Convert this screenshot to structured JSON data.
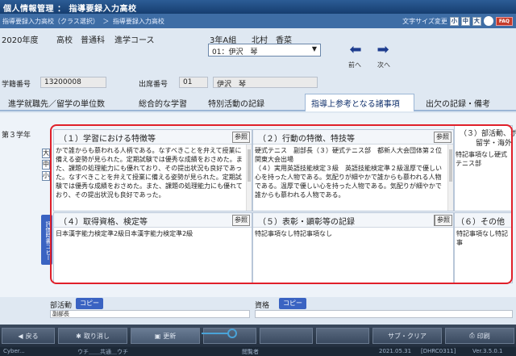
{
  "app": {
    "title": "個人情報管理 ： 指導要録入力高校",
    "breadcrumb": [
      "指導要録入力高校（クラス選択）",
      "＞",
      "指導要録入力高校"
    ],
    "font_size_label": "文字サイズ変更",
    "font_size_buttons": [
      "小",
      "中",
      "大"
    ],
    "faq_button": "FAQ"
  },
  "header": {
    "year": "2020年度",
    "school_type": "高校",
    "course_type": "普通科",
    "course": "進学コース",
    "class": "3年A組",
    "teacher": "北村　香菜",
    "student_select_value": "01：伊沢　琴",
    "prev_label": "前へ",
    "next_label": "次へ"
  },
  "student": {
    "id_label": "学籍番号",
    "id_value": "13200008",
    "seat_label": "出席番号",
    "seat_value": "01",
    "name_value": "伊沢　琴"
  },
  "tabs": [
    {
      "label": "進学就職先／留学の単位数"
    },
    {
      "label": "総合的な学習"
    },
    {
      "label": "特別活動の記録"
    },
    {
      "label": "指導上参考となる諸事項"
    },
    {
      "label": "出欠の記録・備考"
    }
  ],
  "grade": {
    "label": "第３学年",
    "size_buttons": [
      "大",
      "中",
      "小"
    ],
    "copy_vertical": "評価時書コピー"
  },
  "panels": {
    "p1": {
      "title": "（１）学習における特徴等",
      "ref": "参照",
      "body": "かで誰からも慕われる人柄である。なすべきことを弁えて授業に備える姿勢が見られた。定期試験では優秀な成績をおさめた。また、課題の処理能力にも優れており、その提出状況も良好であった。なすべきことを弁えて授業に備える姿勢が見られた。定期試験では優秀な成績をおさめた。また、課題の処理能力にも優れており、その提出状況も良好であった。"
    },
    "p2": {
      "title": "（２）行動の特徴、特技等",
      "ref": "参照",
      "body": "硬式テニス　副部長（３）硬式テニス部　都新人大会団体第２位　関東大会出場\n（４）実用英語技能検定３級　英語技能検定準２級温厚で優しい心を持った人物である。気配りが細やかで誰からも慕われる人物である。温厚で優しい心を持った人物である。気配りが細やかで誰からも慕われる人物である。"
    },
    "p3": {
      "title": "（３）部活動、ボ",
      "subtitle": "留学・海外",
      "body": "特記事項なし硬式テニス部"
    },
    "p4": {
      "title": "（４）取得資格、検定等",
      "ref": "参照",
      "body": "日本漢字能力検定準2級日本漢字能力検定準2級"
    },
    "p5": {
      "title": "（５）表彰・顕彰等の記録",
      "ref": "参照",
      "body": "特記事項なし特記事項なし"
    },
    "p6": {
      "title": "（６）その他",
      "ref": "参照",
      "body": "特記事項なし特記事"
    }
  },
  "lower": {
    "club_label": "部活動",
    "club_copy": "コピー",
    "qual_label": "資格",
    "qual_copy": "コピー",
    "club_box_text": "副部長"
  },
  "toolbar": {
    "buttons": [
      "戻る",
      "取り消し",
      "更新",
      "",
      "",
      "",
      "サブ・クリア",
      "",
      "印刷"
    ]
  },
  "status": {
    "left": "Cyber...",
    "user": "ウチ＿＿共通＿ウチ",
    "mid": "閲覧者",
    "date": "2021.05.31",
    "code": "[DHRC0311]",
    "ver": "Ver.3.5.0.1"
  },
  "colors": {
    "accent": "#3a63c2",
    "frame": "#e0202a",
    "titlebar": "#1b3f70"
  }
}
